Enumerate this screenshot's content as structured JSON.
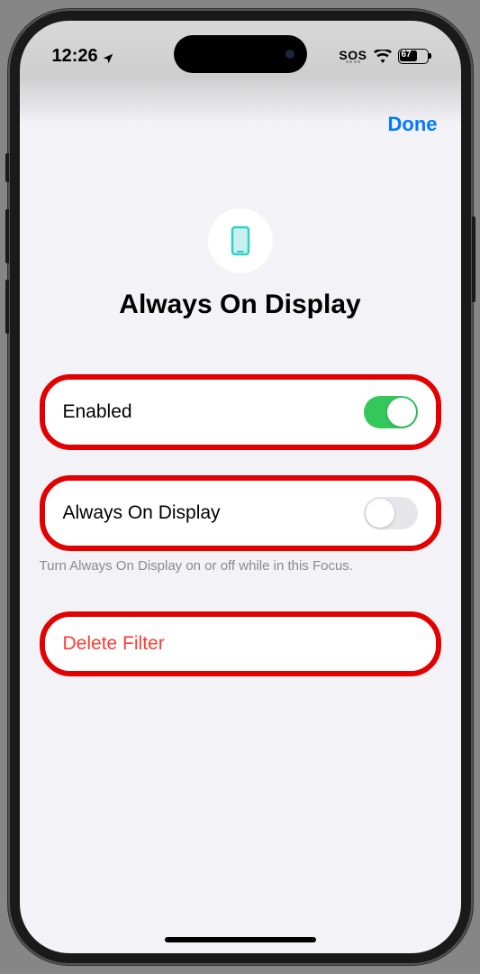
{
  "statusBar": {
    "time": "12:26",
    "sos": "SOS",
    "battery": "67"
  },
  "nav": {
    "done": "Done"
  },
  "header": {
    "title": "Always On Display"
  },
  "settings": {
    "enabled": {
      "label": "Enabled",
      "value": true
    },
    "aod": {
      "label": "Always On Display",
      "value": false
    },
    "footer": "Turn Always On Display on or off while in this Focus."
  },
  "actions": {
    "delete": "Delete Filter"
  }
}
